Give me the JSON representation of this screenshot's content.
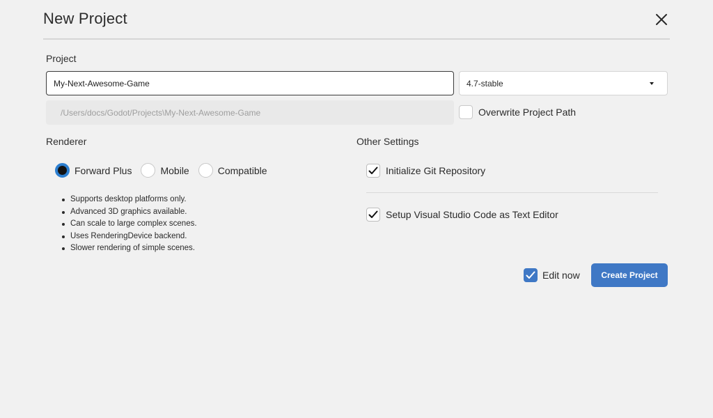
{
  "dialog": {
    "title": "New Project",
    "close_icon": "close-icon"
  },
  "project": {
    "section_label": "Project",
    "name_value": "My-Next-Awesome-Game",
    "version_selected": "4.7-stable",
    "path_value": "/Users/docs/Godot/Projects\\My-Next-Awesome-Game",
    "overwrite_label": "Overwrite Project Path",
    "overwrite_checked": false
  },
  "renderer": {
    "section_label": "Renderer",
    "options": [
      {
        "label": "Forward Plus",
        "selected": true
      },
      {
        "label": "Mobile",
        "selected": false
      },
      {
        "label": "Compatible",
        "selected": false
      }
    ],
    "notes": [
      "Supports desktop platforms only.",
      "Advanced 3D graphics available.",
      "Can scale to large complex scenes.",
      "Uses RenderingDevice backend.",
      "Slower rendering of simple scenes."
    ]
  },
  "other_settings": {
    "section_label": "Other Settings",
    "git_label": "Initialize Git Repository",
    "git_checked": true,
    "vscode_label": "Setup Visual Studio Code as Text Editor",
    "vscode_checked": true
  },
  "footer": {
    "edit_now_label": "Edit now",
    "edit_now_checked": true,
    "create_label": "Create Project"
  },
  "colors": {
    "accent": "#3f78c5",
    "radio_selected": "#2d7fd0",
    "background": "#f1f1f1"
  }
}
